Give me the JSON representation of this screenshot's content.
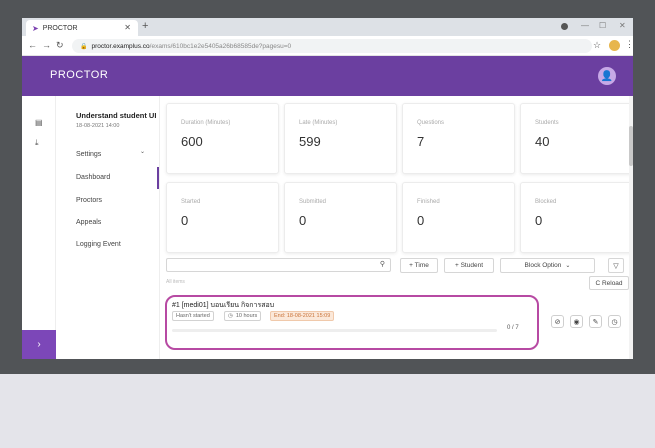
{
  "browser": {
    "tab_title": "PROCTOR",
    "url_host": "proctor.examplus.co",
    "url_path": "/exams/610bc1e2e5405a26b68585de?pagesu=0"
  },
  "app": {
    "brand": "PROCTOR"
  },
  "exam": {
    "title": "Understand student UI",
    "date": "18-08-2021 14:00"
  },
  "sidebar": {
    "items": [
      {
        "label": "Settings"
      },
      {
        "label": "Dashboard"
      },
      {
        "label": "Proctors"
      },
      {
        "label": "Appeals"
      },
      {
        "label": "Logging Event"
      }
    ]
  },
  "stats": [
    {
      "label": "Duration (Minutes)",
      "value": "600"
    },
    {
      "label": "Late (Minutes)",
      "value": "599"
    },
    {
      "label": "Questions",
      "value": "7"
    },
    {
      "label": "Students",
      "value": "40"
    },
    {
      "label": "Started",
      "value": "0"
    },
    {
      "label": "Submitted",
      "value": "0"
    },
    {
      "label": "Finished",
      "value": "0"
    },
    {
      "label": "Blocked",
      "value": "0"
    }
  ],
  "toolbar": {
    "search_placeholder": "",
    "add_time": "+ Time",
    "add_student": "+ Student",
    "block_option": "Block Option",
    "reload": "C Reload"
  },
  "list": {
    "caption": "All items",
    "rows": [
      {
        "title": "#1 [medi01] บอนเรียน กิจการสอบ",
        "status": "Hasn't started",
        "duration": "10 hours",
        "ends": "End: 18-08-2021 15:09",
        "progress_text": "0 / 7",
        "progress": 0
      }
    ]
  }
}
